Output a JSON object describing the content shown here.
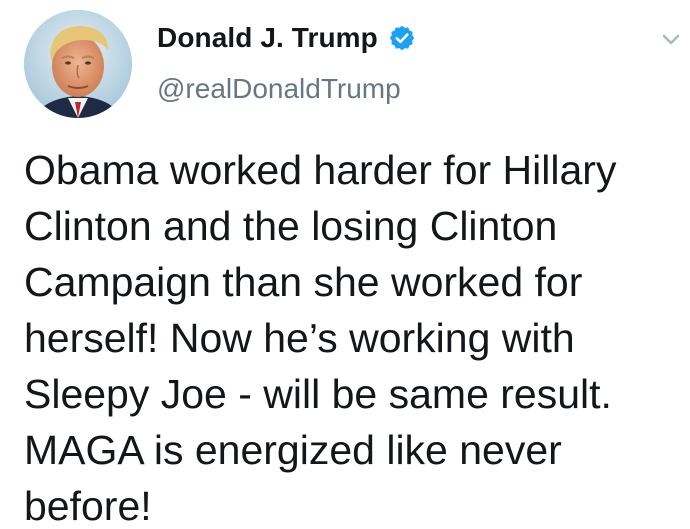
{
  "author": {
    "display_name": "Donald J. Trump",
    "handle": "@realDonaldTrump",
    "verified": true
  },
  "icons": {
    "avatar": "profile-photo",
    "verified": "verified-badge-icon",
    "menu": "chevron-down-icon"
  },
  "colors": {
    "text": "#14171a",
    "secondary_text": "#657786",
    "verified_blue": "#1da1f2",
    "caret": "#aab8c2"
  },
  "tweet": {
    "text": "Obama worked harder for Hillary\nClinton and the losing Clinton\nCampaign than she worked for\nherself! Now he’s working with\nSleepy Joe - will be same result.\nMAGA is energized like never\nbefore!"
  }
}
